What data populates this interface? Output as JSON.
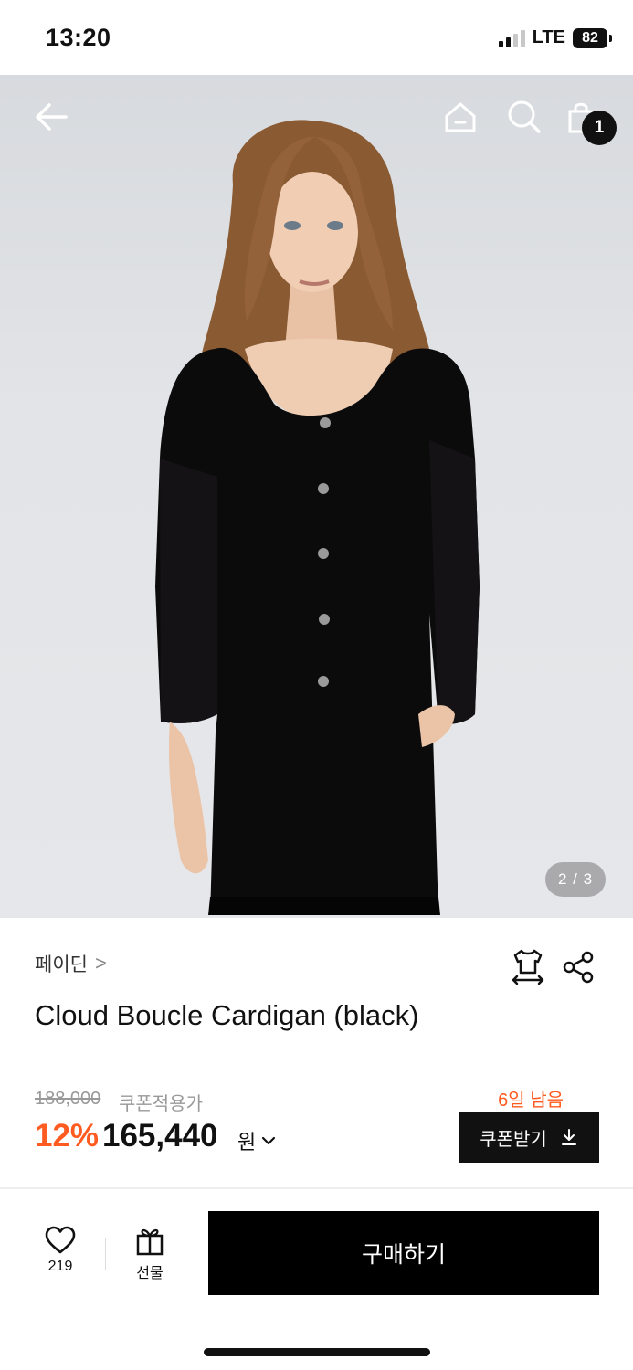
{
  "status_bar": {
    "time": "13:20",
    "network": "LTE",
    "battery": "82"
  },
  "nav": {
    "back_icon": "arrow-left-icon",
    "home_icon": "home-icon",
    "search_icon": "search-icon",
    "cart_icon": "shopping-bag-icon",
    "cart_count": "1"
  },
  "gallery": {
    "counter": "2 / 3"
  },
  "product": {
    "brand": "페이딘",
    "brand_chevron": ">",
    "title": "Cloud Boucle Cardigan (black)",
    "fit_icon": "size-fit-icon",
    "share_icon": "share-icon"
  },
  "price": {
    "original": "188,000",
    "coupon_label": "쿠폰적용가",
    "discount": "12%",
    "final": "165,440",
    "unit": "원",
    "days_left": "6일 남음",
    "coupon_button": "쿠폰받기"
  },
  "bottom_bar": {
    "like_count": "219",
    "gift_label": "선물",
    "buy_button": "구매하기"
  },
  "colors": {
    "accent": "#ff5a1f",
    "primary": "#000000"
  }
}
